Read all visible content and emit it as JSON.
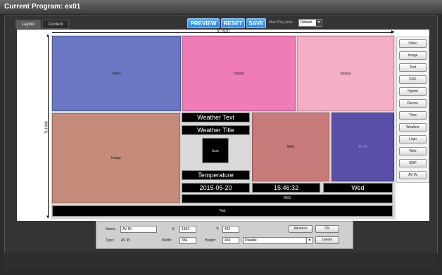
{
  "window": {
    "title": "Current Program: ex01"
  },
  "tabs": [
    {
      "label": "Layout",
      "active": true
    },
    {
      "label": "Content",
      "active": false
    }
  ],
  "toolbar": {
    "preview_label": "PREVIEW",
    "reset_label": "RESET",
    "save_label": "SAVE",
    "main_play_area_label": "Main Play Area",
    "main_play_area_value": "Default"
  },
  "canvas": {
    "x_dimension": "X:1920",
    "y_dimension": "Y:1080"
  },
  "regions": {
    "video": "Video",
    "hybrid": "Hybrid",
    "device": "Device",
    "image": "Image",
    "web": "Web",
    "avin": "AV IN",
    "weather_text": "Weather Text",
    "weather_title": "Weather Title",
    "icon": "Icon",
    "temperature": "Temperature",
    "date": "2015-05-20",
    "time": "15:46:32",
    "day": "Wed",
    "rss": "RSS",
    "text": "Text"
  },
  "palette": {
    "items": [
      "Video",
      "Image",
      "Text",
      "RSS",
      "Hybrid",
      "Device",
      "Time",
      "Weather",
      "Logo",
      "Web",
      "SWF",
      "AV IN"
    ]
  },
  "properties": {
    "name_label": "Name:",
    "name_value": "AV IN",
    "type_label": "Type:",
    "type_value": "AV IN",
    "x_label": "X:",
    "x_value": "1563",
    "y_label": "Y:",
    "y_value": "452",
    "width_label": "Width:",
    "width_value": "356",
    "height_label": "Height:",
    "height_value": "404",
    "state_value": "Disable",
    "advance_label": "Advance",
    "ok_label": "OK",
    "delete_label": "Delete"
  },
  "colors": {
    "accent": "#2a8cf0",
    "video": "#6b77c2",
    "hybrid": "#f07cb5",
    "device": "#f5aec3",
    "image": "#c48a7a",
    "web": "#c77a7a",
    "avin": "#5a4fa8"
  }
}
